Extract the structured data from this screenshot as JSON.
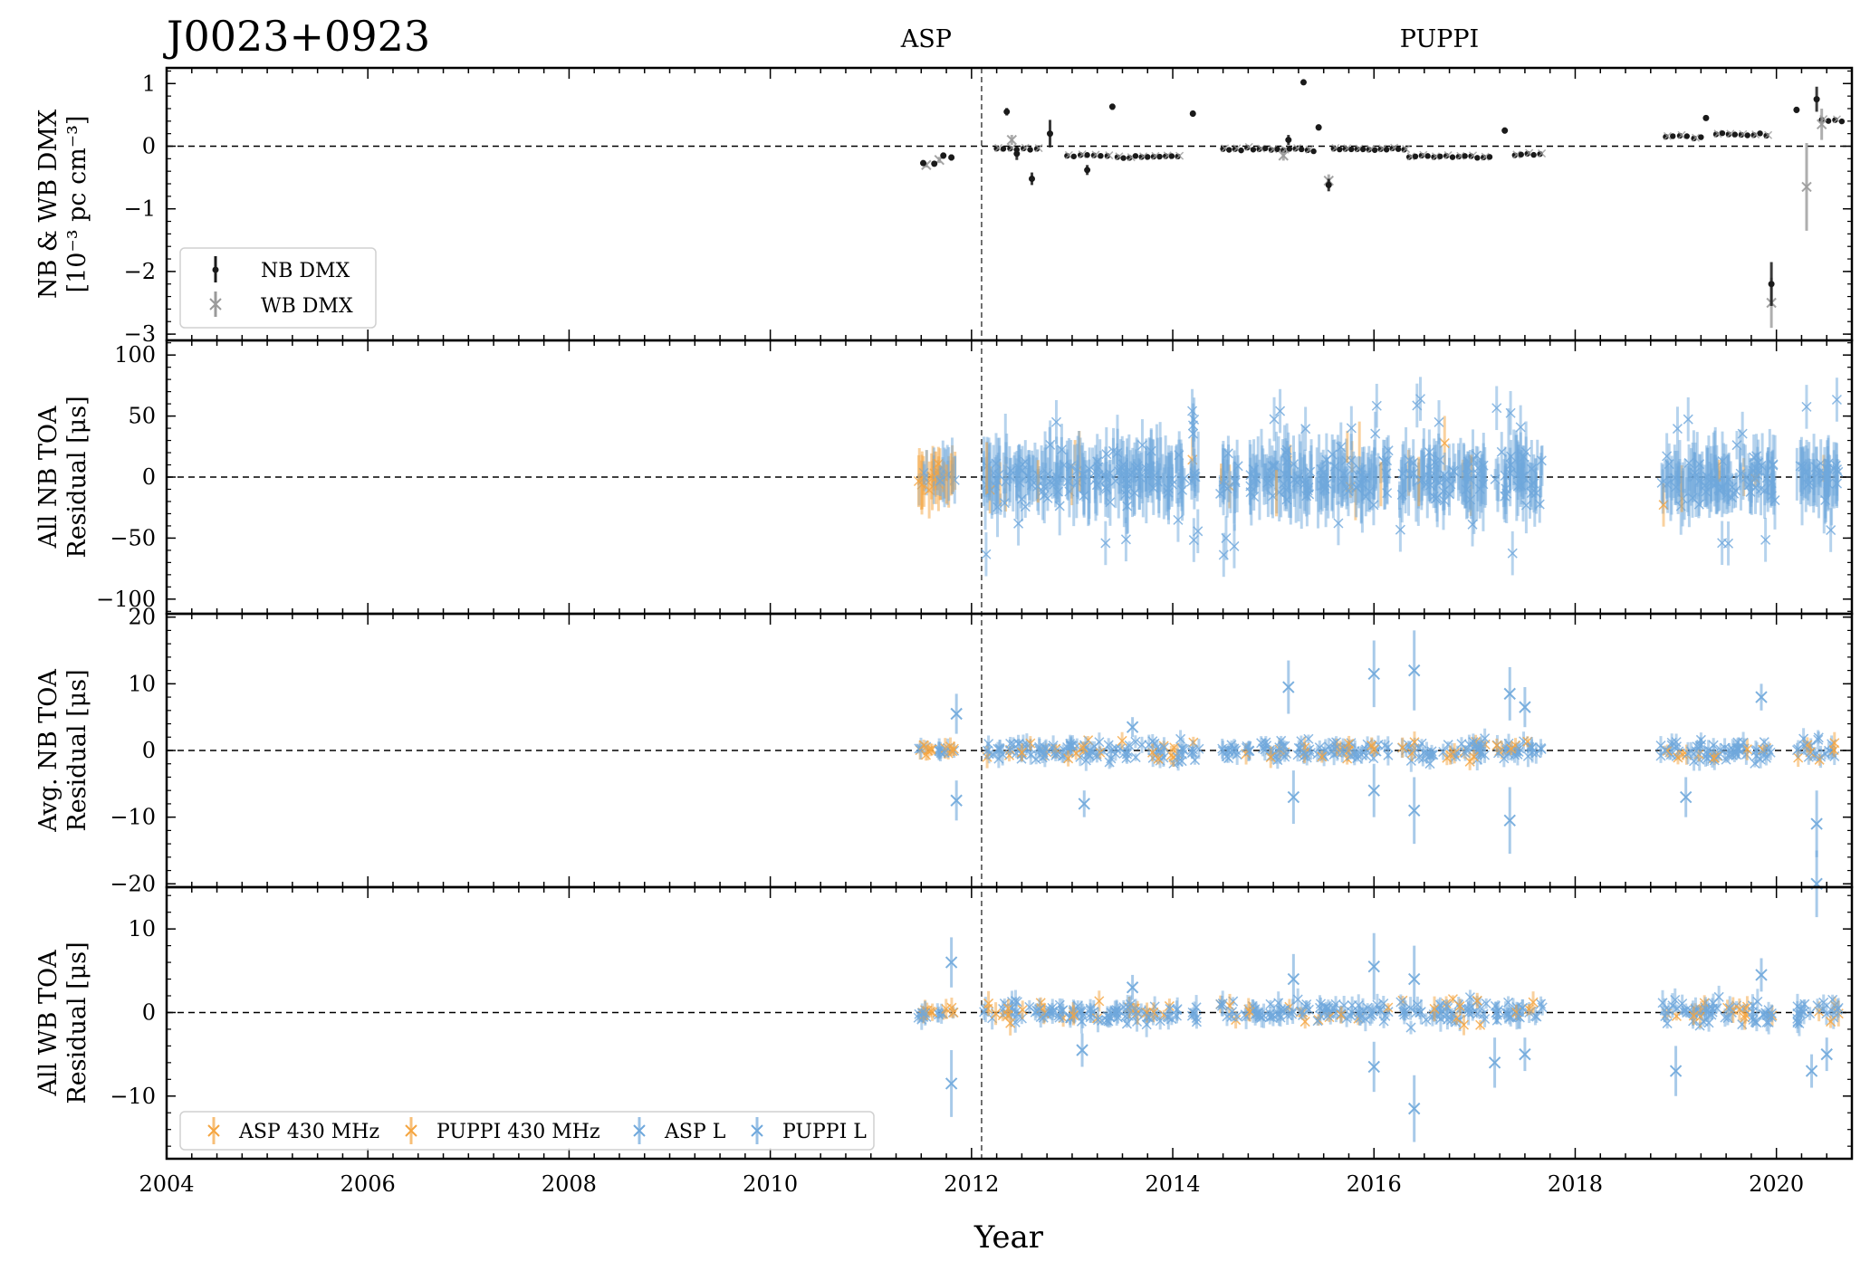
{
  "title": "J0023+0923",
  "backend_labels": [
    "ASP",
    "PUPPI"
  ],
  "colors": {
    "nb_dmx": "#1a1a1a",
    "wb_dmx": "#9a9a9a",
    "asp_430": "#f5a540",
    "puppi_430": "#f5a540",
    "asp_l": "#6fa8dc",
    "puppi_l": "#6fa8dc",
    "frame": "#000000"
  },
  "chart_data": {
    "type": "scatter",
    "x_axis": {
      "label": "Year",
      "range": [
        2004,
        2020.75
      ],
      "ticks": [
        "2004",
        "2006",
        "2008",
        "2010",
        "2012",
        "2014",
        "2016",
        "2018",
        "2020"
      ]
    },
    "backend_transition_year": 2012.1,
    "panels": [
      {
        "id": "dmx",
        "ylabel": [
          "NB & WB DMX",
          "[10⁻³ pc cm⁻³]"
        ],
        "ylim": [
          -3.1,
          1.25
        ],
        "yticks": [
          "1",
          "0",
          "−1",
          "−2",
          "−3"
        ],
        "ytick_values": [
          1,
          0,
          -1,
          -2,
          -3
        ],
        "legend": [
          "NB DMX",
          "WB DMX"
        ],
        "legend_position": "lower-left",
        "series": [
          {
            "name": "NB DMX",
            "marker": "dot",
            "points": [
              [
                2011.52,
                -0.27,
                0.04
              ],
              [
                2011.63,
                -0.28,
                0.04
              ],
              [
                2011.72,
                -0.15,
                0.05
              ],
              [
                2011.8,
                -0.18,
                0.05
              ],
              [
                2012.35,
                0.55,
                0.06
              ],
              [
                2012.45,
                -0.12,
                0.1
              ],
              [
                2012.6,
                -0.52,
                0.1
              ],
              [
                2012.78,
                0.2,
                0.22
              ],
              [
                2013.15,
                -0.38,
                0.08
              ],
              [
                2013.4,
                0.63,
                0.05
              ],
              [
                2014.2,
                0.52,
                0.05
              ],
              [
                2015.15,
                0.1,
                0.08
              ],
              [
                2015.3,
                1.02,
                0.04
              ],
              [
                2015.45,
                0.3,
                0.05
              ],
              [
                2015.55,
                -0.62,
                0.1
              ],
              [
                2017.3,
                0.25,
                0.05
              ],
              [
                2019.3,
                0.45,
                0.04
              ],
              [
                2019.95,
                -2.2,
                0.35
              ],
              [
                2020.2,
                0.58,
                0.05
              ],
              [
                2020.4,
                0.75,
                0.2
              ]
            ]
          },
          {
            "name": "WB DMX",
            "marker": "x",
            "points": [
              [
                2011.55,
                -0.3,
                0.04
              ],
              [
                2011.68,
                -0.22,
                0.05
              ],
              [
                2012.4,
                0.1,
                0.08
              ],
              [
                2015.1,
                -0.15,
                0.08
              ],
              [
                2015.55,
                -0.55,
                0.1
              ],
              [
                2019.95,
                -2.5,
                0.4
              ],
              [
                2020.3,
                -0.65,
                0.7
              ],
              [
                2020.45,
                0.35,
                0.25
              ]
            ]
          }
        ]
      },
      {
        "id": "nb_all",
        "ylabel": [
          "All NB TOA",
          "Residual [μs]"
        ],
        "ylim": [
          -112,
          112
        ],
        "yticks": [
          "100",
          "50",
          "0",
          "−50",
          "−100"
        ],
        "ytick_values": [
          100,
          50,
          0,
          -50,
          -100
        ]
      },
      {
        "id": "nb_avg",
        "ylabel": [
          "Avg. NB TOA",
          "Residual [μs]"
        ],
        "ylim": [
          -20.5,
          20.5
        ],
        "yticks": [
          "20",
          "10",
          "0",
          "−10",
          "−20"
        ],
        "ytick_values": [
          20,
          10,
          0,
          -10,
          -20
        ]
      },
      {
        "id": "wb_all",
        "ylabel": [
          "All WB TOA",
          "Residual [μs]"
        ],
        "ylim": [
          -17.5,
          15
        ],
        "yticks": [
          "10",
          "0",
          "−10"
        ],
        "ytick_values": [
          10,
          0,
          -10
        ],
        "legend": [
          "ASP 430 MHz",
          "PUPPI 430 MHz",
          "ASP L",
          "PUPPI L"
        ],
        "legend_position": "lower-left"
      }
    ],
    "observation_segments": [
      {
        "start": 2011.47,
        "end": 2011.84,
        "backend": "ASP"
      },
      {
        "start": 2012.12,
        "end": 2012.92,
        "backend": "PUPPI"
      },
      {
        "start": 2012.95,
        "end": 2014.12,
        "backend": "PUPPI"
      },
      {
        "start": 2014.18,
        "end": 2014.27,
        "backend": "PUPPI"
      },
      {
        "start": 2014.47,
        "end": 2014.65,
        "backend": "PUPPI"
      },
      {
        "start": 2014.72,
        "end": 2015.38,
        "backend": "PUPPI"
      },
      {
        "start": 2015.42,
        "end": 2016.15,
        "backend": "PUPPI"
      },
      {
        "start": 2016.25,
        "end": 2017.12,
        "backend": "PUPPI"
      },
      {
        "start": 2017.2,
        "end": 2017.68,
        "backend": "PUPPI"
      },
      {
        "start": 2018.85,
        "end": 2020.0,
        "backend": "PUPPI"
      },
      {
        "start": 2020.2,
        "end": 2020.62,
        "backend": "PUPPI"
      }
    ],
    "dmx_baselines": [
      {
        "start": 2012.25,
        "end": 2012.65,
        "value": -0.05
      },
      {
        "start": 2012.95,
        "end": 2013.35,
        "value": -0.15
      },
      {
        "start": 2013.45,
        "end": 2014.05,
        "value": -0.17
      },
      {
        "start": 2014.5,
        "end": 2015.4,
        "value": -0.05
      },
      {
        "start": 2015.6,
        "end": 2016.3,
        "value": -0.05
      },
      {
        "start": 2016.35,
        "end": 2017.15,
        "value": -0.17
      },
      {
        "start": 2017.4,
        "end": 2017.65,
        "value": -0.13
      },
      {
        "start": 2018.9,
        "end": 2019.25,
        "value": 0.15
      },
      {
        "start": 2019.4,
        "end": 2019.9,
        "value": 0.18
      },
      {
        "start": 2020.45,
        "end": 2020.65,
        "value": 0.42
      }
    ],
    "nb_avg_outliers": [
      [
        2015.15,
        9.5,
        4
      ],
      [
        2015.2,
        -7,
        4
      ],
      [
        2016.0,
        11.5,
        5
      ],
      [
        2016.0,
        -6,
        4
      ],
      [
        2016.4,
        12,
        6
      ],
      [
        2016.4,
        -9,
        5
      ],
      [
        2017.35,
        8.5,
        4
      ],
      [
        2017.35,
        -10.5,
        5
      ],
      [
        2017.5,
        6.5,
        3
      ],
      [
        2013.12,
        -8,
        2
      ],
      [
        2011.85,
        5.5,
        3
      ],
      [
        2011.85,
        -7.5,
        3
      ],
      [
        2013.6,
        3.5,
        1.5
      ],
      [
        2019.85,
        8,
        2
      ],
      [
        2019.1,
        -7,
        3
      ],
      [
        2020.4,
        -11,
        5
      ],
      [
        2020.4,
        -20,
        5
      ]
    ],
    "wb_outliers": [
      [
        2016.4,
        -11.5,
        4
      ],
      [
        2016.4,
        4,
        4
      ],
      [
        2016.0,
        5.5,
        4
      ],
      [
        2016.0,
        -6.5,
        3
      ],
      [
        2011.8,
        -8.5,
        4
      ],
      [
        2011.8,
        6,
        3
      ],
      [
        2015.2,
        4,
        3
      ],
      [
        2017.2,
        -6,
        3
      ],
      [
        2017.5,
        -5,
        2
      ],
      [
        2019.85,
        4.5,
        2
      ],
      [
        2019.0,
        -7,
        3
      ],
      [
        2020.35,
        -7,
        2
      ],
      [
        2020.5,
        -5,
        2
      ],
      [
        2013.6,
        3,
        1.5
      ],
      [
        2013.1,
        -4.5,
        2
      ]
    ]
  }
}
